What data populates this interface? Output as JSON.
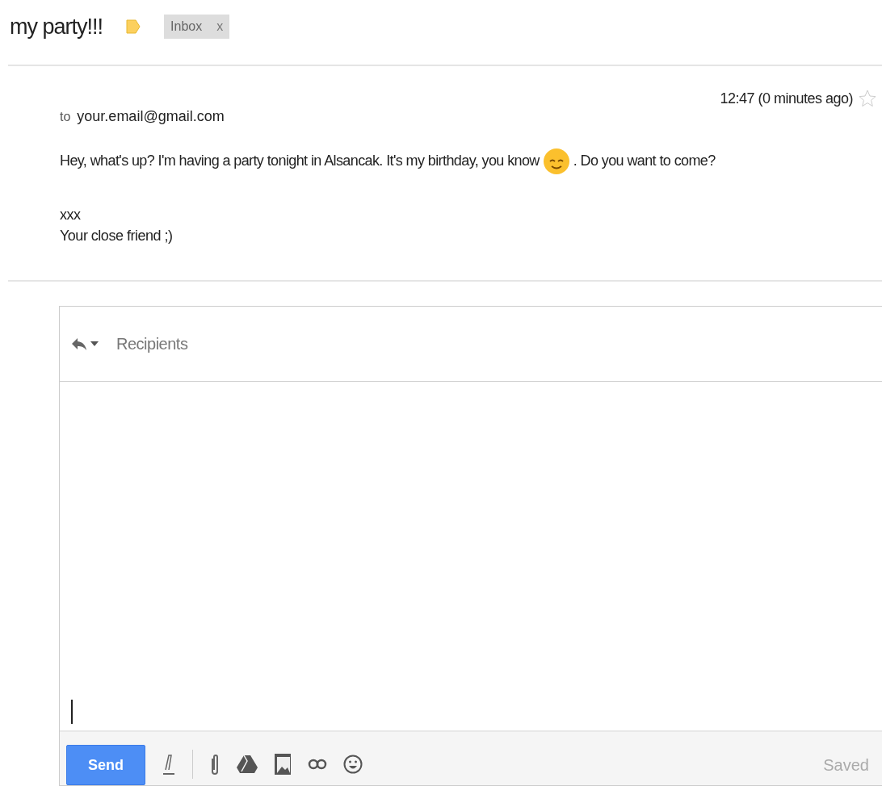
{
  "subject": "my party!!!",
  "important": true,
  "labels": [
    {
      "name": "Inbox",
      "remove": "x"
    }
  ],
  "message": {
    "time": "12:47 (0 minutes ago)",
    "starred": false,
    "to_label": "to",
    "to": "your.email@gmail.com",
    "body_before": "Hey, what's up? I'm having a party tonight in Alsancak. It's my birthday, you know",
    "body_after": ". Do you want to come?",
    "signature": [
      "xxx",
      "Your close friend ;)"
    ]
  },
  "reply": {
    "placeholder": "Recipients",
    "send": "Send",
    "status": "Saved"
  }
}
